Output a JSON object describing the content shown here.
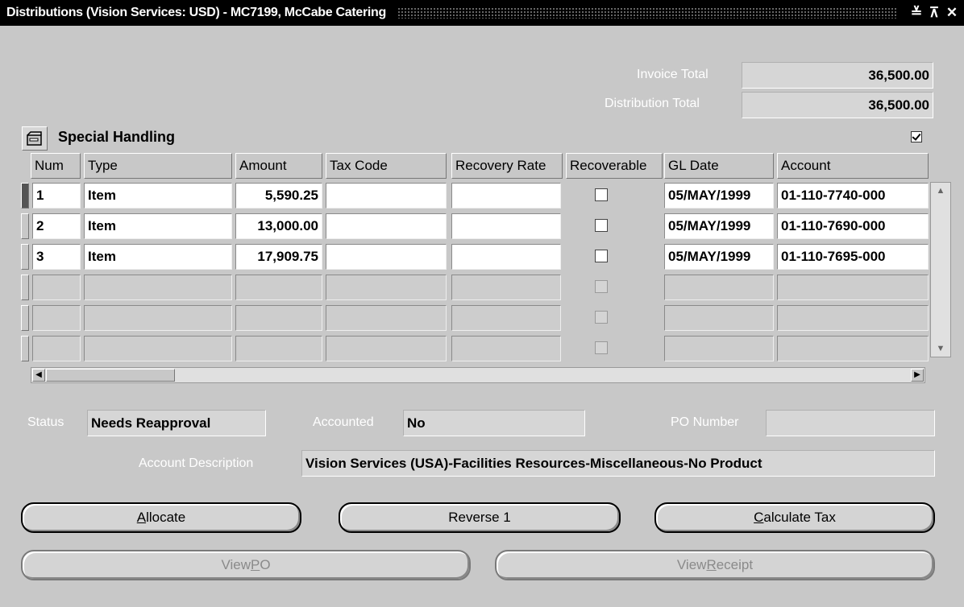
{
  "window": {
    "title": "Distributions (Vision Services: USD) - MC7199, McCabe Catering",
    "minimize": "≚",
    "maximize": "⊼",
    "close": "✕"
  },
  "totals": {
    "invoice_total_label": "Invoice Total",
    "invoice_total": "36,500.00",
    "distribution_total_label": "Distribution Total",
    "distribution_total": "36,500.00"
  },
  "special_handling": {
    "label": "Special Handling",
    "checked": true
  },
  "table": {
    "columns": [
      "Num",
      "Type",
      "Amount",
      "Tax Code",
      "Recovery Rate",
      "Recoverable",
      "GL Date",
      "Account"
    ],
    "rows": [
      {
        "num": "1",
        "type": "Item",
        "amount": "5,590.25",
        "tax_code": "",
        "recovery_rate": "",
        "recoverable": false,
        "gl_date": "05/MAY/1999",
        "account": "01-110-7740-000"
      },
      {
        "num": "2",
        "type": "Item",
        "amount": "13,000.00",
        "tax_code": "",
        "recovery_rate": "",
        "recoverable": false,
        "gl_date": "05/MAY/1999",
        "account": "01-110-7690-000"
      },
      {
        "num": "3",
        "type": "Item",
        "amount": "17,909.75",
        "tax_code": "",
        "recovery_rate": "",
        "recoverable": false,
        "gl_date": "05/MAY/1999",
        "account": "01-110-7695-000"
      }
    ],
    "empty_rows": 3
  },
  "details": {
    "status_label": "Status",
    "status": "Needs Reapproval",
    "accounted_label": "Accounted",
    "accounted": "No",
    "po_number_label": "PO Number",
    "po_number": "",
    "account_description_label": "Account Description",
    "account_description": "Vision Services (USA)-Facilities Resources-Miscellaneous-No Product"
  },
  "buttons": {
    "allocate": {
      "pre": "",
      "mn": "A",
      "post": "llocate"
    },
    "reverse": {
      "label": "Reverse 1"
    },
    "calculate_tax": {
      "pre": "",
      "mn": "C",
      "post": "alculate Tax"
    },
    "view_po": {
      "pre": "View ",
      "mn": "P",
      "post": "O"
    },
    "view_receipt": {
      "pre": "View ",
      "mn": "R",
      "post": "eceipt"
    }
  },
  "colors": {
    "titlebar": "#000000",
    "background": "#c8c8c8",
    "field_active": "#ffffff",
    "field_readonly": "#d6d6d6"
  }
}
